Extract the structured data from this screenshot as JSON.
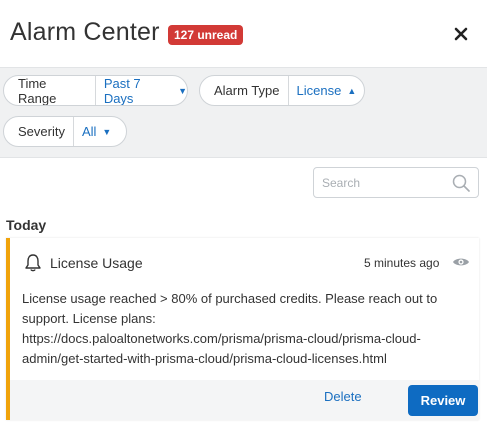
{
  "header": {
    "title": "Alarm Center",
    "unread_badge": "127 unread",
    "close_icon": "close-icon"
  },
  "filters": {
    "time_range": {
      "label": "Time Range",
      "value": "Past 7 Days",
      "chevron": "chevron-down-icon"
    },
    "alarm_type": {
      "label": "Alarm Type",
      "value": "License",
      "chevron": "chevron-up-icon"
    },
    "severity": {
      "label": "Severity",
      "value": "All",
      "chevron": "chevron-down-icon"
    }
  },
  "search": {
    "placeholder": "Search",
    "value": "",
    "icon": "search-icon"
  },
  "groups": [
    {
      "label": "Today",
      "alarms": [
        {
          "icon": "bell-icon",
          "title": "License Usage",
          "time": "5 minutes ago",
          "view_icon": "eye-icon",
          "message_line1": "License usage reached > 80% of purchased credits. Please reach out to",
          "message_line2": "support. License plans:",
          "message_line3": "https://docs.paloaltonetworks.com/prisma/prisma-cloud/prisma-cloud-",
          "message_line4": "admin/get-started-with-prisma-cloud/prisma-cloud-licenses.html",
          "delete_label": "Delete",
          "review_label": "Review",
          "accent_color": "#f0a30a"
        }
      ]
    }
  ],
  "colors": {
    "badge": "#d23a36",
    "link": "#1a6fc0",
    "primary_button": "#0e6bc2"
  }
}
